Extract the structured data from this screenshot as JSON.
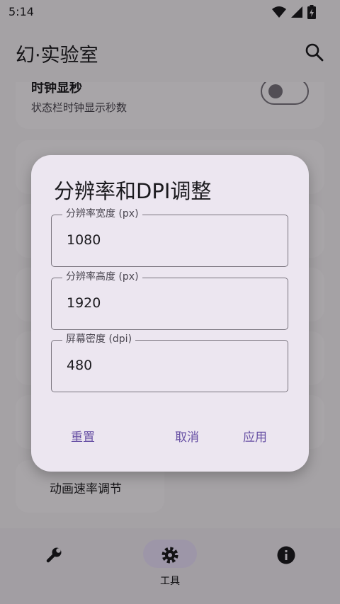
{
  "status_bar": {
    "time": "5:14"
  },
  "app_bar": {
    "title": "幻·实验室"
  },
  "clock_card": {
    "title": "时钟显秒",
    "subtitle": "状态栏时钟显示秒数",
    "switch_on": false
  },
  "animation_card": {
    "label": "动画速率调节"
  },
  "bottom_nav": {
    "tools_label": "工具",
    "selected": "tools"
  },
  "dialog": {
    "title": "分辨率和DPI调整",
    "fields": [
      {
        "label": "分辨率宽度 (px)",
        "value": "1080"
      },
      {
        "label": "分辨率高度 (px)",
        "value": "1920"
      },
      {
        "label": "屏幕密度 (dpi)",
        "value": "480"
      }
    ],
    "buttons": {
      "reset": "重置",
      "cancel": "取消",
      "apply": "应用"
    }
  },
  "colors": {
    "accent": "#6750a4",
    "scrim": "rgba(0,0,0,0.32)",
    "dialog_bg": "#ece6f0"
  }
}
